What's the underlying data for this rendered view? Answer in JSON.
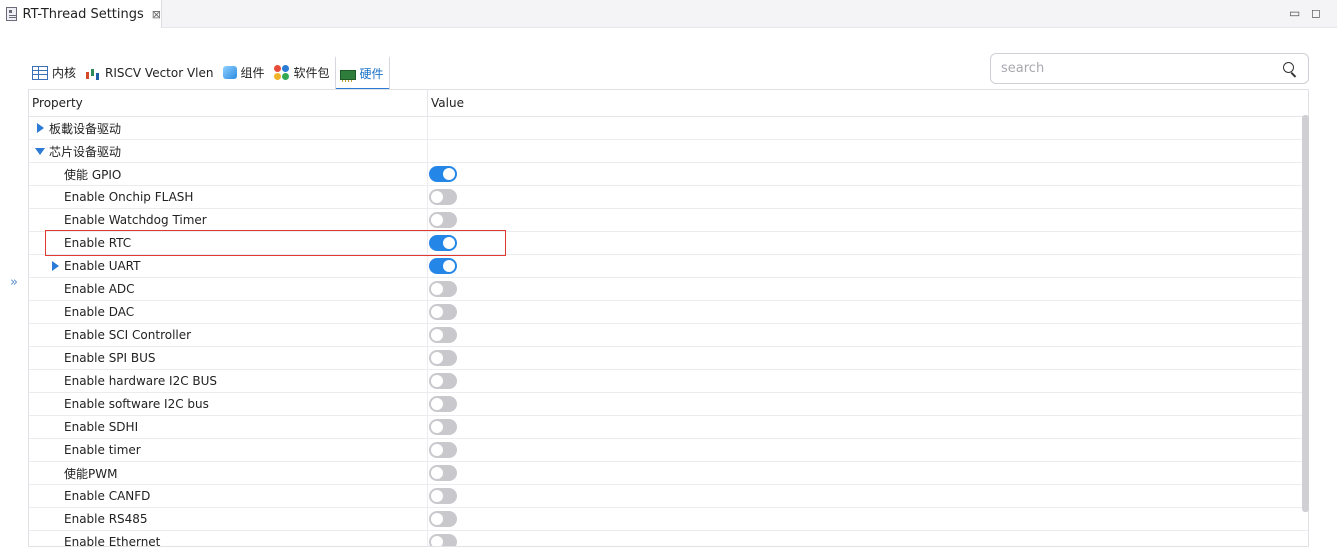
{
  "editor": {
    "tab_title": "RT-Thread Settings",
    "close_glyph": "⊠",
    "minimize_glyph": "▭",
    "maximize_glyph": "◻"
  },
  "expander_glyph": "»",
  "tabs": [
    {
      "label": "内核",
      "icon": "table-icon",
      "active": false
    },
    {
      "label": "RISCV Vector Vlen",
      "icon": "chart-icon",
      "active": false
    },
    {
      "label": "组件",
      "icon": "cube-icon",
      "active": false
    },
    {
      "label": "软件包",
      "icon": "package-icon",
      "active": false
    },
    {
      "label": "硬件",
      "icon": "hardware-board-icon",
      "active": true
    }
  ],
  "search": {
    "placeholder": "search",
    "value": ""
  },
  "table": {
    "headers": {
      "property": "Property",
      "value": "Value"
    },
    "rows": [
      {
        "label": "板載设备驱动",
        "level": 0,
        "twisty": "collapsed",
        "toggle": null
      },
      {
        "label": "芯片设备驱动",
        "level": 0,
        "twisty": "expanded",
        "toggle": null
      },
      {
        "label": "使能 GPIO",
        "level": 1,
        "twisty": null,
        "toggle": true
      },
      {
        "label": "Enable Onchip FLASH",
        "level": 1,
        "twisty": null,
        "toggle": false
      },
      {
        "label": "Enable Watchdog Timer",
        "level": 1,
        "twisty": null,
        "toggle": false
      },
      {
        "label": "Enable RTC",
        "level": 1,
        "twisty": null,
        "toggle": true
      },
      {
        "label": "Enable UART",
        "level": 1,
        "twisty": "collapsed",
        "toggle": true
      },
      {
        "label": "Enable ADC",
        "level": 1,
        "twisty": null,
        "toggle": false
      },
      {
        "label": "Enable DAC",
        "level": 1,
        "twisty": null,
        "toggle": false
      },
      {
        "label": "Enable SCI Controller",
        "level": 1,
        "twisty": null,
        "toggle": false
      },
      {
        "label": "Enable SPI BUS",
        "level": 1,
        "twisty": null,
        "toggle": false
      },
      {
        "label": "Enable hardware I2C BUS",
        "level": 1,
        "twisty": null,
        "toggle": false
      },
      {
        "label": "Enable software I2C bus",
        "level": 1,
        "twisty": null,
        "toggle": false
      },
      {
        "label": "Enable SDHI",
        "level": 1,
        "twisty": null,
        "toggle": false
      },
      {
        "label": "Enable timer",
        "level": 1,
        "twisty": null,
        "toggle": false
      },
      {
        "label": "使能PWM",
        "level": 1,
        "twisty": null,
        "toggle": false
      },
      {
        "label": "Enable CANFD",
        "level": 1,
        "twisty": null,
        "toggle": false
      },
      {
        "label": "Enable RS485",
        "level": 1,
        "twisty": null,
        "toggle": false
      },
      {
        "label": "Enable Ethernet",
        "level": 1,
        "twisty": null,
        "toggle": false
      }
    ]
  },
  "colors": {
    "accent": "#2487e8",
    "toggle_off": "#c9c9cd",
    "highlight_box": "#e03a2f"
  }
}
